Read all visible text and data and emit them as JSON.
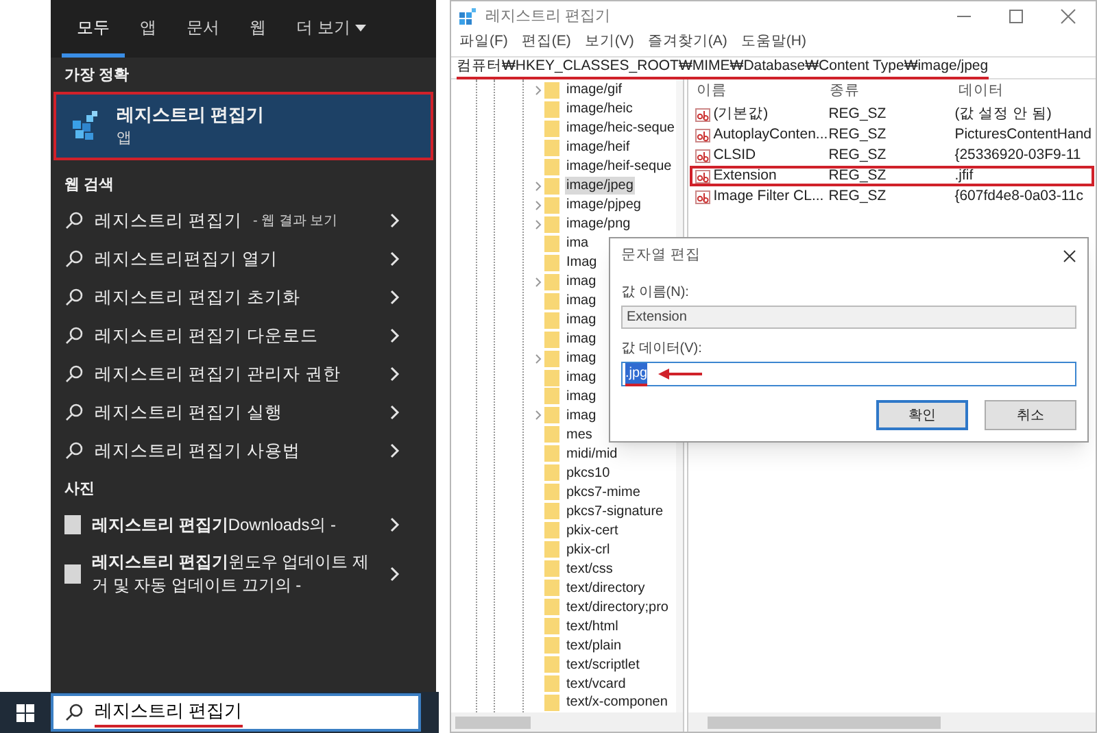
{
  "search_panel": {
    "tabs": [
      {
        "label": "모두",
        "selected": true,
        "kind": "tab"
      },
      {
        "label": "앱",
        "selected": false,
        "kind": "tab"
      },
      {
        "label": "문서",
        "selected": false,
        "kind": "tab"
      },
      {
        "label": "웹",
        "selected": false,
        "kind": "tab"
      },
      {
        "label": "더 보기",
        "selected": false,
        "kind": "dropdown"
      }
    ],
    "best_match": {
      "heading": "가장 정확",
      "title": "레지스트리 편집기",
      "subtitle": "앱",
      "highlighted": true
    },
    "web_search": {
      "heading": "웹 검색",
      "items": [
        {
          "text": "레지스트리 편집기",
          "suffix": "- 웹 결과 보기"
        },
        {
          "text": "레지스트리편집기 열기"
        },
        {
          "text": "레지스트리 편집기 초기화"
        },
        {
          "text": "레지스트리 편집기 다운로드"
        },
        {
          "text": "레지스트리 편집기 관리자 권한"
        },
        {
          "text": "레지스트리 편집기 실행"
        },
        {
          "text": "레지스트리 편집기 사용법"
        }
      ]
    },
    "photos": {
      "heading": "사진",
      "items": [
        {
          "text": "**레지스트리 편집기**Downloads의 -"
        },
        {
          "text": "**레지스트리 편집기**윈도우 업데이트 제거 및 자동 업데이트 끄기의 -"
        }
      ]
    }
  },
  "taskbar": {
    "search_value": "레지스트리 편집기",
    "underlined": true
  },
  "registry": {
    "window": {
      "title": "레지스트리 편집기"
    },
    "menu": [
      "파일(F)",
      "편집(E)",
      "보기(V)",
      "즐겨찾기(A)",
      "도움말(H)"
    ],
    "address": {
      "path": "컴퓨터₩HKEY_CLASSES_ROOT₩MIME₩Database₩Content Type₩image/jpeg",
      "underlined": true
    },
    "tree": [
      {
        "label": "image/gif",
        "expandable": true,
        "selected": false
      },
      {
        "label": "image/heic",
        "expandable": false,
        "selected": false
      },
      {
        "label": "image/heic-seque",
        "expandable": false,
        "selected": false
      },
      {
        "label": "image/heif",
        "expandable": false,
        "selected": false
      },
      {
        "label": "image/heif-seque",
        "expandable": false,
        "selected": false
      },
      {
        "label": "image/jpeg",
        "expandable": true,
        "selected": true
      },
      {
        "label": "image/pjpeg",
        "expandable": true,
        "selected": false
      },
      {
        "label": "image/png",
        "expandable": true,
        "selected": false
      },
      {
        "label": "ima",
        "expandable": false,
        "selected": false
      },
      {
        "label": "Imag",
        "expandable": false,
        "selected": false
      },
      {
        "label": "imag",
        "expandable": true,
        "selected": false
      },
      {
        "label": "imag",
        "expandable": false,
        "selected": false
      },
      {
        "label": "imag",
        "expandable": false,
        "selected": false
      },
      {
        "label": "imag",
        "expandable": false,
        "selected": false
      },
      {
        "label": "imag",
        "expandable": true,
        "selected": false
      },
      {
        "label": "imag",
        "expandable": false,
        "selected": false
      },
      {
        "label": "imag",
        "expandable": false,
        "selected": false
      },
      {
        "label": "imag",
        "expandable": true,
        "selected": false
      },
      {
        "label": "mes",
        "expandable": false,
        "selected": false
      },
      {
        "label": "midi/mid",
        "expandable": false,
        "selected": false
      },
      {
        "label": "pkcs10",
        "expandable": false,
        "selected": false
      },
      {
        "label": "pkcs7-mime",
        "expandable": false,
        "selected": false
      },
      {
        "label": "pkcs7-signature",
        "expandable": false,
        "selected": false
      },
      {
        "label": "pkix-cert",
        "expandable": false,
        "selected": false
      },
      {
        "label": "pkix-crl",
        "expandable": false,
        "selected": false
      },
      {
        "label": "text/css",
        "expandable": false,
        "selected": false
      },
      {
        "label": "text/directory",
        "expandable": false,
        "selected": false
      },
      {
        "label": "text/directory;pro",
        "expandable": false,
        "selected": false
      },
      {
        "label": "text/html",
        "expandable": false,
        "selected": false
      },
      {
        "label": "text/plain",
        "expandable": false,
        "selected": false
      },
      {
        "label": "text/scriptlet",
        "expandable": false,
        "selected": false
      },
      {
        "label": "text/vcard",
        "expandable": false,
        "selected": false
      },
      {
        "label": "text/x-componen",
        "expandable": false,
        "selected": false
      }
    ],
    "columns": [
      "이름",
      "종류",
      "데이터"
    ],
    "values": [
      {
        "name": "(기본값)",
        "type": "REG_SZ",
        "data": "(값 설정 안 됨)",
        "highlighted": false
      },
      {
        "name": "AutoplayConten...",
        "type": "REG_SZ",
        "data": "PicturesContentHand",
        "highlighted": false
      },
      {
        "name": "CLSID",
        "type": "REG_SZ",
        "data": "{25336920-03F9-11",
        "highlighted": false
      },
      {
        "name": "Extension",
        "type": "REG_SZ",
        "data": ".jfif",
        "highlighted": true
      },
      {
        "name": "Image Filter CL...",
        "type": "REG_SZ",
        "data": "{607fd4e8-0a03-11c",
        "highlighted": false
      }
    ],
    "dialog": {
      "title": "문자열 편집",
      "name_label": "값 이름(N):",
      "name_value": "Extension",
      "data_label": "값 데이터(V):",
      "data_value": ".jpg",
      "data_selected": true,
      "data_marked": true,
      "buttons": [
        {
          "label": "확인",
          "default": true
        },
        {
          "label": "취소",
          "default": false
        }
      ]
    }
  }
}
